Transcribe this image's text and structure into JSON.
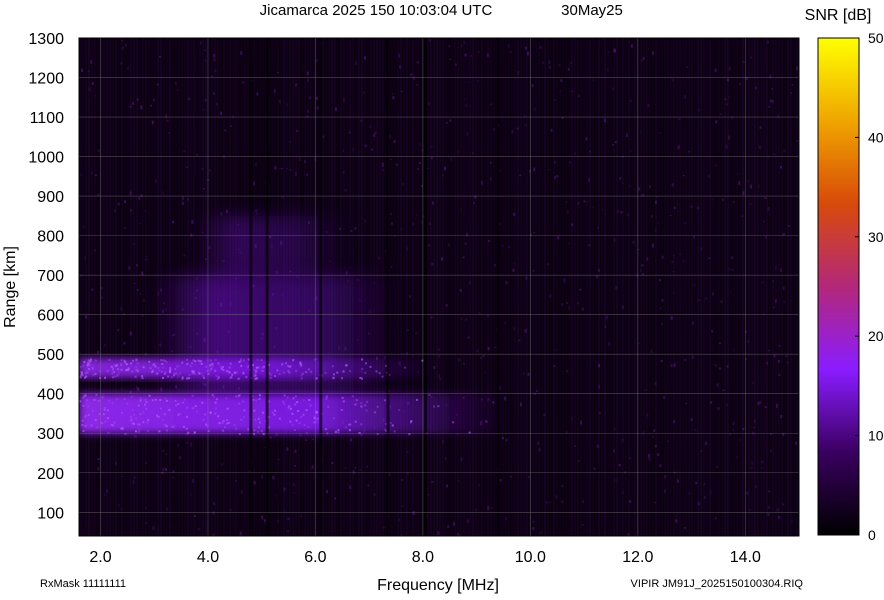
{
  "header": {
    "title": "Jicamarca 2025 150 10:03:04 UTC",
    "date": "30May25"
  },
  "colorbar": {
    "title": "SNR [dB]",
    "ticks": [
      "0",
      "10",
      "20",
      "30",
      "40",
      "50"
    ],
    "min": 0,
    "max": 50,
    "colors": [
      "#000000",
      "#3a0060",
      "#8a1cff",
      "#b3287a",
      "#d84a0a",
      "#f0a500",
      "#ffff00"
    ]
  },
  "footer": {
    "rxmask": "RxMask 11111111",
    "file": "VIPIR  JM91J_2025150100304.RIQ"
  },
  "chart_data": {
    "type": "heatmap",
    "title": "Jicamarca 2025 150 10:03:04 UTC",
    "xlabel": "Frequency [MHz]",
    "ylabel": "Range [km]",
    "xlim": [
      1.6,
      15.0
    ],
    "ylim": [
      40,
      1300
    ],
    "x_ticks": [
      "2.0",
      "4.0",
      "6.0",
      "8.0",
      "10.0",
      "12.0",
      "14.0"
    ],
    "y_ticks": [
      "100",
      "200",
      "300",
      "400",
      "500",
      "600",
      "700",
      "800",
      "900",
      "1000",
      "1100",
      "1200",
      "1300"
    ],
    "grid": true,
    "colorscale": "SNR [dB] 0–50",
    "background_snr_db": 3,
    "echo_regions": [
      {
        "f_start": 1.6,
        "f_end": 9.6,
        "range_start": 300,
        "range_end": 400,
        "snr_db": 12
      },
      {
        "f_start": 1.6,
        "f_end": 8.2,
        "range_start": 440,
        "range_end": 490,
        "snr_db": 11
      },
      {
        "f_start": 3.0,
        "f_end": 7.6,
        "range_start": 400,
        "range_end": 700,
        "snr_db": 9
      },
      {
        "f_start": 3.8,
        "f_end": 6.6,
        "range_start": 700,
        "range_end": 850,
        "snr_db": 6
      }
    ],
    "interference_lines_mhz": [
      4.8,
      5.1,
      6.1,
      7.35,
      8.05,
      9.4
    ]
  }
}
